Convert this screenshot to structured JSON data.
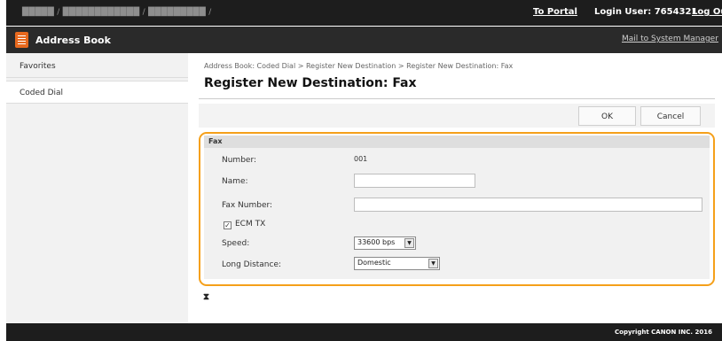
{
  "topbar": {
    "breadcrumb": "█████  /  ████████████ / █████████ /",
    "portal_link": "To Portal",
    "login_user": "Login User:  7654321",
    "logout_link": "Log Out"
  },
  "appbar": {
    "icon": "address-book-icon",
    "title": "Address Book",
    "mail_link": "Mail to System Manager"
  },
  "sidebar": {
    "items": [
      {
        "label": "Favorites"
      },
      {
        "label": "Coded Dial"
      }
    ]
  },
  "main": {
    "breadcrumb": "Address Book: Coded Dial > Register New Destination > Register New Destination: Fax",
    "title": "Register New Destination: Fax",
    "ok_label": "OK",
    "cancel_label": "Cancel",
    "fax": {
      "section_title": "Fax",
      "number_label": "Number:",
      "number_value": "001",
      "name_label": "Name:",
      "name_value": "",
      "fax_number_label": "Fax Number:",
      "fax_number_value": "",
      "ecm_label": "ECM TX",
      "ecm_checked": true,
      "speed_label": "Speed:",
      "speed_value": "33600 bps",
      "long_distance_label": "Long Distance:",
      "long_distance_value": "Domestic"
    },
    "sort_icon": "sort-icon"
  },
  "footer": {
    "copyright": "Copyright CANON INC. 2016"
  },
  "colors": {
    "highlight_frame": "#f5a01a",
    "app_icon": "#e8691e",
    "topbar_bg": "#1d1d1d"
  }
}
